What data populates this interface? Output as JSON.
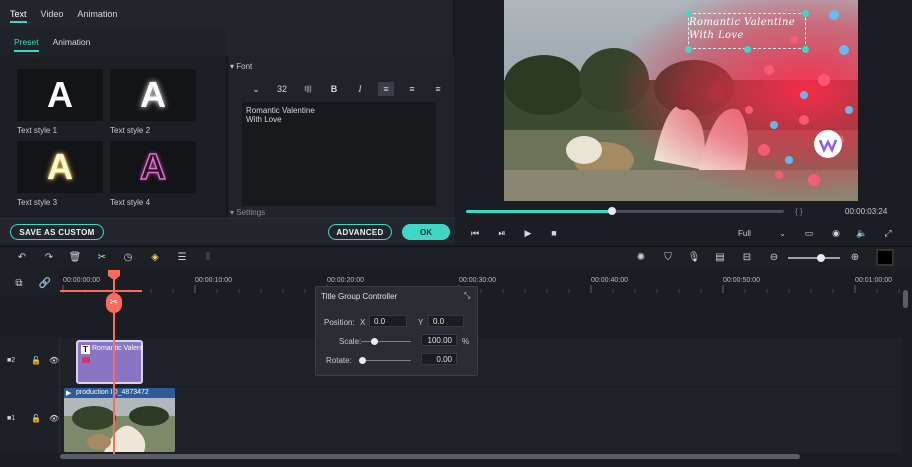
{
  "top_tabs": [
    "Text",
    "Video",
    "Animation"
  ],
  "sub_tabs": [
    "Preset",
    "Animation"
  ],
  "presets": [
    {
      "label": "Text style 1",
      "glyph": "A"
    },
    {
      "label": "Text style 2",
      "glyph": "A"
    },
    {
      "label": "Text style 3",
      "glyph": "A"
    },
    {
      "label": "Text style 4",
      "glyph": "A"
    }
  ],
  "font_section": {
    "heading": "Font",
    "size": "32",
    "text_value": "Romantic Valentine\nWith Love",
    "settings_heading": "Settings"
  },
  "buttons": {
    "save_as_custom": "SAVE AS CUSTOM",
    "advanced": "ADVANCED",
    "ok": "OK"
  },
  "preview": {
    "overlay_text": "Romantic Valentine\nWith Love",
    "timecode": "00:00:03:24",
    "brackets": "{    }",
    "zoom_select": "Full",
    "progress": 0.46
  },
  "ruler": {
    "labels": [
      "00:00:00:00",
      "00:00:10:00",
      "00:00:20:00",
      "00:00:30:00",
      "00:00:40:00",
      "00:00:50:00",
      "00:01:00:00"
    ]
  },
  "tracks": [
    {
      "index": "2",
      "clip_label": "Romantic Valent"
    },
    {
      "index": "1",
      "clip_label": "production ID_4873472"
    }
  ],
  "title_group_controller": {
    "title": "Title Group Controller",
    "position_label": "Position:",
    "x_label": "X",
    "y_label": "Y",
    "x_value": "0.0",
    "y_value": "0.0",
    "scale_label": "Scale:",
    "scale_value": "100.00",
    "scale_unit": "%",
    "rotate_label": "Rotate:",
    "rotate_value": "0.00"
  },
  "colors": {
    "accent": "#3fd6c5",
    "playhead": "#ff6a5a",
    "title_clip": "#8a74c4",
    "video_clip": "#3a6bb0"
  }
}
